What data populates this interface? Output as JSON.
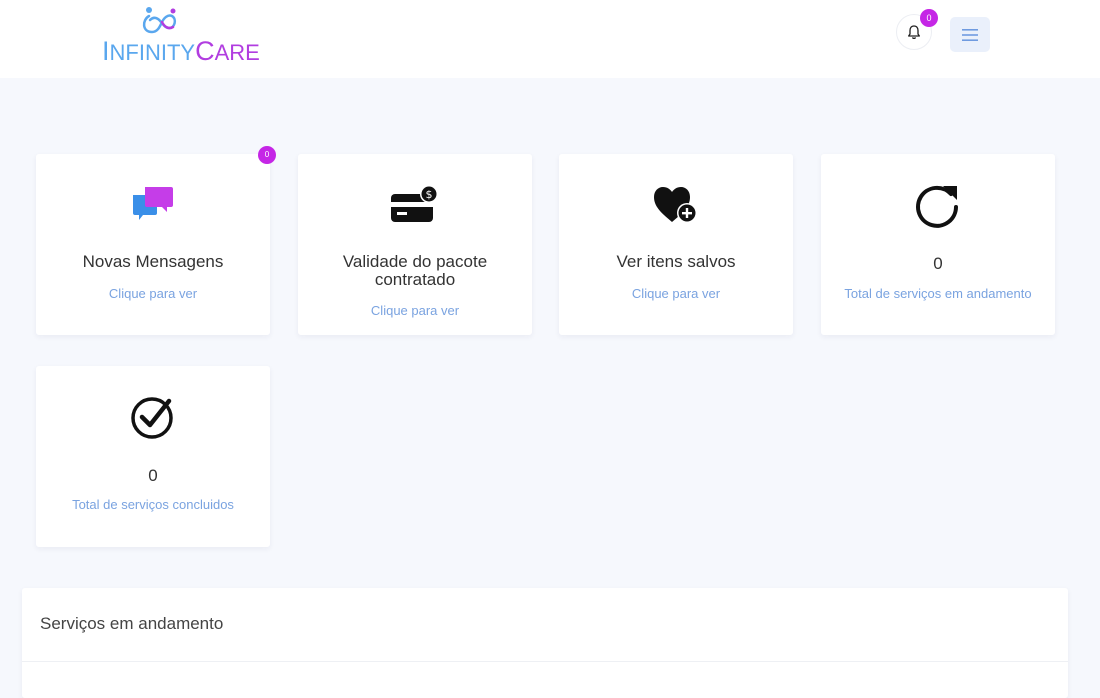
{
  "header": {
    "logo": {
      "first_letter_1": "I",
      "rest_1": "NFINITY",
      "first_letter_2": "C",
      "rest_2": "ARE",
      "colors": {
        "primary": "#5aa7ee",
        "secondary": "#b13de0"
      }
    },
    "notifications": {
      "icon": "bell-icon",
      "count": "0"
    },
    "menu": {
      "icon": "hamburger-menu-icon"
    }
  },
  "cards": [
    {
      "icon": "chat-bubbles-icon",
      "title": "Novas Mensagens",
      "link": "Clique para ver",
      "badge": "0"
    },
    {
      "icon": "credit-card-dollar-icon",
      "title": "Validade do pacote contratado",
      "link": "Clique para ver"
    },
    {
      "icon": "heart-plus-icon",
      "title": "Ver itens salvos",
      "link": "Clique para ver"
    },
    {
      "icon": "refresh-icon",
      "value": "0",
      "link": "Total de serviços em andamento"
    },
    {
      "icon": "check-circle-icon",
      "value": "0",
      "link": "Total de serviços concluidos"
    }
  ],
  "panel": {
    "title": "Serviços em andamento"
  },
  "colors": {
    "background": "#f6f8fd",
    "link": "#7aa3e0",
    "badge": "#c526e6"
  }
}
